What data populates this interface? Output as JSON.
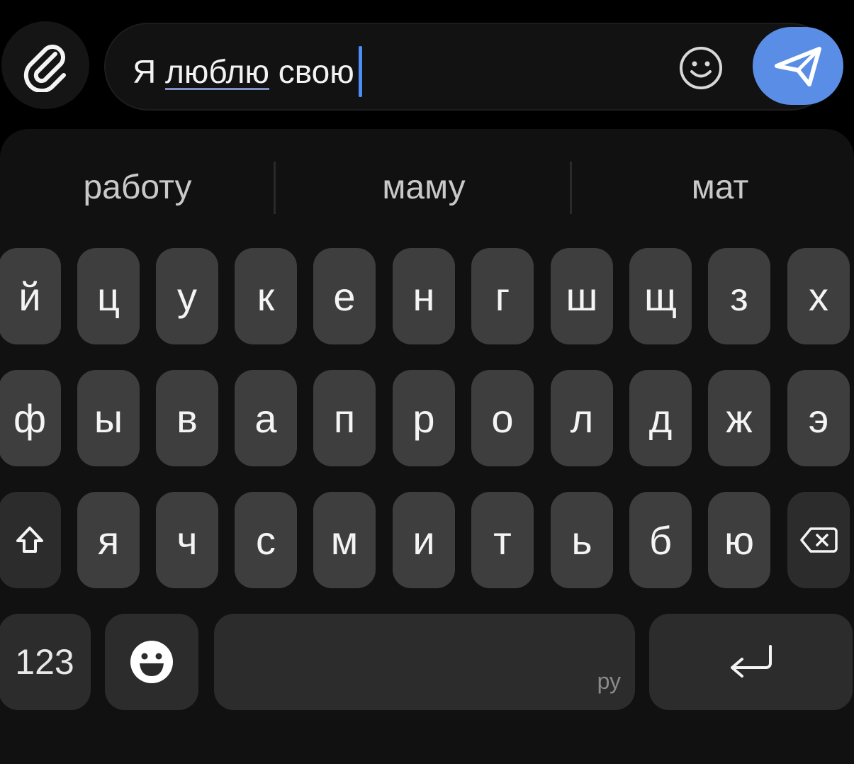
{
  "input": {
    "prefix": "Я ",
    "underlined_word": "люблю",
    "suffix": " свою"
  },
  "suggestions": [
    "работу",
    "маму",
    "мат"
  ],
  "keyboard": {
    "row1": [
      "й",
      "ц",
      "у",
      "к",
      "е",
      "н",
      "г",
      "ш",
      "щ",
      "з",
      "х"
    ],
    "row2": [
      "ф",
      "ы",
      "в",
      "а",
      "п",
      "р",
      "о",
      "л",
      "д",
      "ж",
      "э"
    ],
    "row3": [
      "я",
      "ч",
      "с",
      "м",
      "и",
      "т",
      "ь",
      "б",
      "ю"
    ],
    "numbers_label": "123",
    "language_label": "ру"
  },
  "icons": {
    "attach": "paperclip-icon",
    "emoji_field": "smiley-icon",
    "send": "send-icon",
    "shift": "shift-icon",
    "backspace": "backspace-icon",
    "emoji_key": "emoji-icon",
    "enter": "enter-icon"
  },
  "colors": {
    "accent": "#5a8ee6",
    "caret": "#4c8df6",
    "key": "#3e3e3e",
    "function_key": "#2c2c2c",
    "background": "#000000"
  }
}
